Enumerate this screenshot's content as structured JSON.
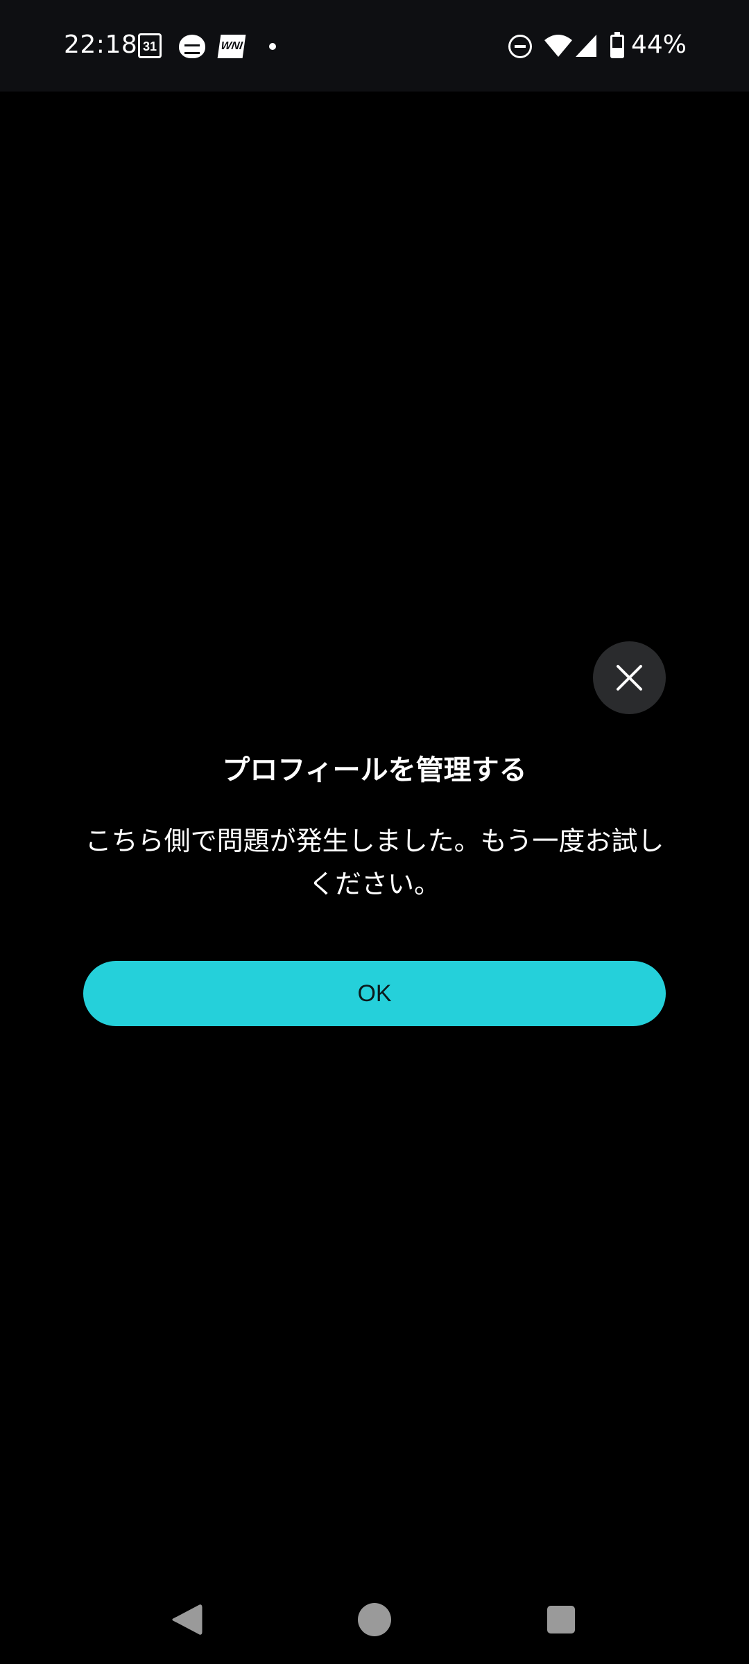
{
  "status_bar": {
    "time": "22:18",
    "calendar_day": "31",
    "wni_label": "WNI",
    "battery_percent_text": "44%",
    "battery_level": 0.44,
    "icons": [
      "calendar-icon",
      "weather-app-icon",
      "wni-icon",
      "notification-dot",
      "do-not-disturb-icon",
      "wifi-icon",
      "signal-icon",
      "battery-icon"
    ]
  },
  "dialog": {
    "close_icon": "close-icon",
    "title": "プロフィールを管理する",
    "message": "こちら側で問題が発生しました。もう一度お試しください。",
    "ok_label": "OK"
  },
  "nav_bar": {
    "icons": [
      "back-icon",
      "home-icon",
      "recents-icon"
    ]
  },
  "colors": {
    "background": "#000000",
    "status_bar": "#0e0f12",
    "accent": "#25d0da",
    "close_button_bg": "#2a2b2d",
    "nav_icon": "#9a9a9a"
  }
}
